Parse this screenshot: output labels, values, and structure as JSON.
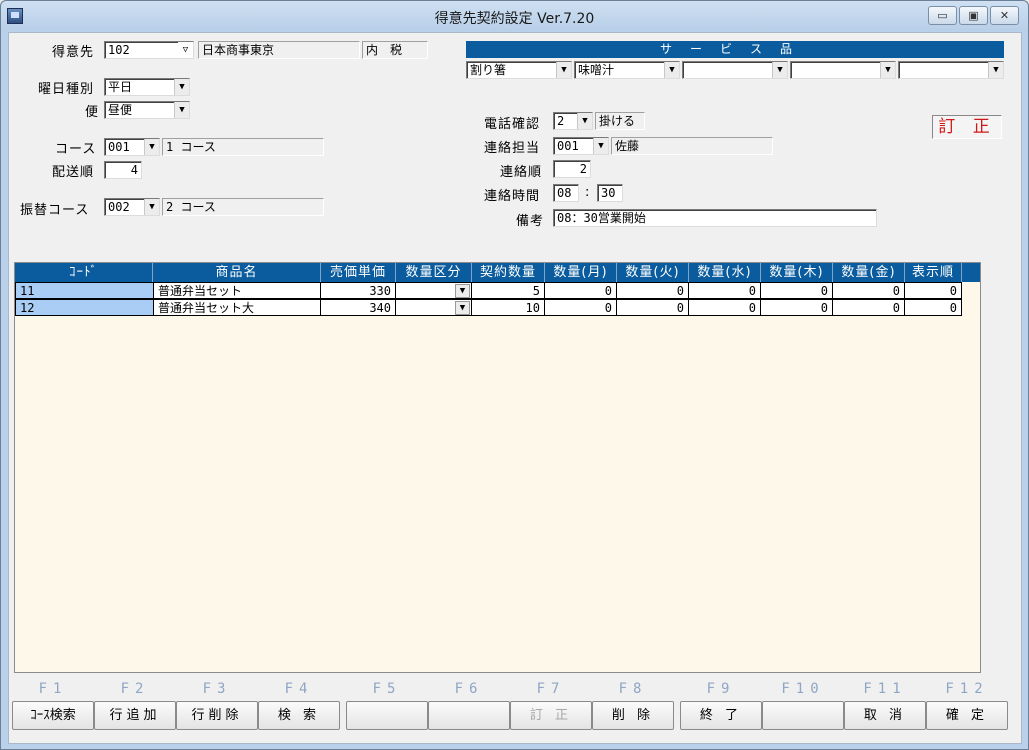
{
  "window": {
    "title": "得意先契約設定 Ver.7.20",
    "min_glyph": "▭",
    "max_glyph": "▣",
    "close_glyph": "✕"
  },
  "customer": {
    "label": "得意先",
    "code": "102",
    "name": "日本商事東京",
    "tax": "内　税"
  },
  "day_type": {
    "label": "曜日種別",
    "value": "平日"
  },
  "delivery": {
    "label": "便",
    "value": "昼便"
  },
  "course": {
    "label": "コース",
    "code": "001",
    "name": "1 コース"
  },
  "delivery_order": {
    "label": "配送順",
    "value": "4"
  },
  "transfer_course": {
    "label": "振替コース",
    "code": "002",
    "name": "2 コース"
  },
  "service": {
    "header": "サービス品",
    "items": [
      "割り箸",
      "味噌汁",
      "",
      "",
      ""
    ]
  },
  "phone_confirm": {
    "label": "電話確認",
    "code": "2",
    "text": "掛ける"
  },
  "contact_person": {
    "label": "連絡担当",
    "code": "001",
    "name": "佐藤"
  },
  "contact_order": {
    "label": "連絡順",
    "value": "2"
  },
  "contact_time": {
    "label": "連絡時間",
    "hour": "08",
    "sep": ":",
    "minute": "30"
  },
  "remarks": {
    "label": "備考",
    "value": "08：30営業開始"
  },
  "mode_badge": "訂 正",
  "grid": {
    "headers": [
      "ｺｰﾄﾞ",
      "商品名",
      "売価単価",
      "数量区分",
      "契約数量",
      "数量(月)",
      "数量(火)",
      "数量(水)",
      "数量(木)",
      "数量(金)",
      "表示順"
    ],
    "rows": [
      {
        "code": "11",
        "name": "普通弁当セット",
        "price": "330",
        "qty_type": "",
        "contract": "5",
        "mon": "0",
        "tue": "0",
        "wed": "0",
        "thu": "0",
        "fri": "0",
        "order": "0"
      },
      {
        "code": "12",
        "name": "普通弁当セット大",
        "price": "340",
        "qty_type": "",
        "contract": "10",
        "mon": "0",
        "tue": "0",
        "wed": "0",
        "thu": "0",
        "fri": "0",
        "order": "0"
      }
    ]
  },
  "function_keys": [
    {
      "key": "F1",
      "label": "ｺｰｽ検索"
    },
    {
      "key": "F2",
      "label": "行追加"
    },
    {
      "key": "F3",
      "label": "行削除"
    },
    {
      "key": "F4",
      "label": "検 索"
    },
    {
      "key": "F5",
      "label": ""
    },
    {
      "key": "F6",
      "label": ""
    },
    {
      "key": "F7",
      "label": "訂 正"
    },
    {
      "key": "F8",
      "label": "削 除"
    },
    {
      "key": "F9",
      "label": "終 了"
    },
    {
      "key": "F10",
      "label": ""
    },
    {
      "key": "F11",
      "label": "取 消"
    },
    {
      "key": "F12",
      "label": "確 定"
    }
  ],
  "colors": {
    "header_blue": "#0a5c9e",
    "code_cell": "#a9cdf5",
    "grid_bg": "#fdf8e9",
    "badge_red": "#d01818",
    "fkey_label": "#8fa6c4"
  }
}
